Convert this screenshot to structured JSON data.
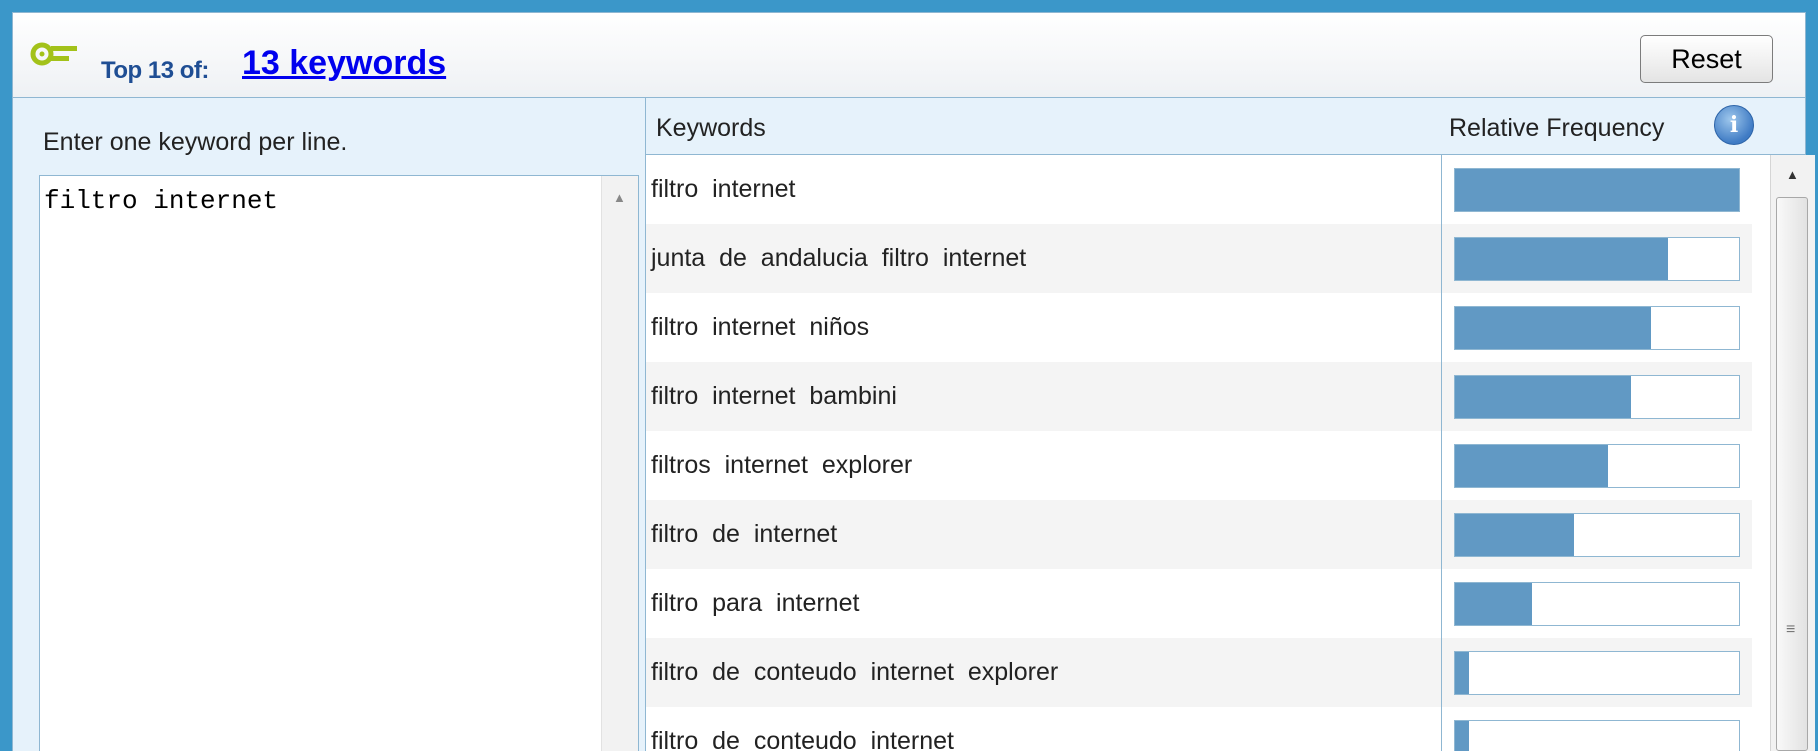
{
  "header": {
    "top_label": "Top 13 of:",
    "keywords_link": "13 keywords",
    "reset_label": "Reset"
  },
  "input_panel": {
    "hint": "Enter one keyword per line.",
    "value": "filtro internet"
  },
  "results": {
    "col_keywords": "Keywords",
    "col_frequency": "Relative Frequency",
    "info_icon": "i",
    "rows": [
      {
        "keyword": "filtro  internet",
        "frequency": 1.0
      },
      {
        "keyword": "junta  de  andalucia  filtro  internet",
        "frequency": 0.75
      },
      {
        "keyword": "filtro  internet  niños",
        "frequency": 0.69
      },
      {
        "keyword": "filtro  internet  bambini",
        "frequency": 0.62
      },
      {
        "keyword": "filtros  internet  explorer",
        "frequency": 0.54
      },
      {
        "keyword": "filtro  de  internet",
        "frequency": 0.42
      },
      {
        "keyword": "filtro  para  internet",
        "frequency": 0.27
      },
      {
        "keyword": "filtro  de  conteudo  internet  explorer",
        "frequency": 0.05
      },
      {
        "keyword": "filtro  de  conteudo  internet",
        "frequency": 0.05
      }
    ]
  },
  "colors": {
    "frame": "#3b97c9",
    "bar": "#6199c4",
    "link": "#0000ee",
    "title": "#1f4e94"
  }
}
